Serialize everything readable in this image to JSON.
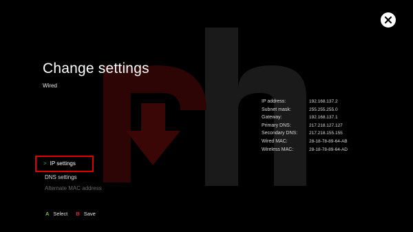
{
  "header": {
    "title": "Change settings",
    "subtitle": "Wired"
  },
  "menu": {
    "items": [
      {
        "label": "IP settings",
        "state": "selected"
      },
      {
        "label": "DNS settings",
        "state": "normal"
      },
      {
        "label": "Alternate MAC address",
        "state": "disabled"
      }
    ]
  },
  "info": {
    "rows": [
      {
        "label": "IP address:",
        "value": "192.168.137.2"
      },
      {
        "label": "Subnet mask:",
        "value": "255.255.255.0"
      },
      {
        "label": "Gateway:",
        "value": "192.168.137.1"
      },
      {
        "label": "Primary DNS:",
        "value": "217.218.127.127"
      },
      {
        "label": "Secondary DNS:",
        "value": "217.218.155.155"
      },
      {
        "label": "Wired MAC:",
        "value": "28-18-78-89-64-AB"
      },
      {
        "label": "Wireless MAC:",
        "value": "28-18-78-89-64-AD"
      }
    ]
  },
  "footer": {
    "select_key": "A",
    "select_label": "Select",
    "save_key": "B",
    "save_label": "Save"
  },
  "icons": {
    "logo": "xbox-logo-icon",
    "chevron": "chevron-right-icon"
  },
  "colors": {
    "background": "#000000",
    "highlight_border": "#e00000",
    "a_button": "#7cc242",
    "b_button": "#e2262f",
    "watermark_red": "#3a0606",
    "watermark_gray": "#1a1a1a"
  }
}
